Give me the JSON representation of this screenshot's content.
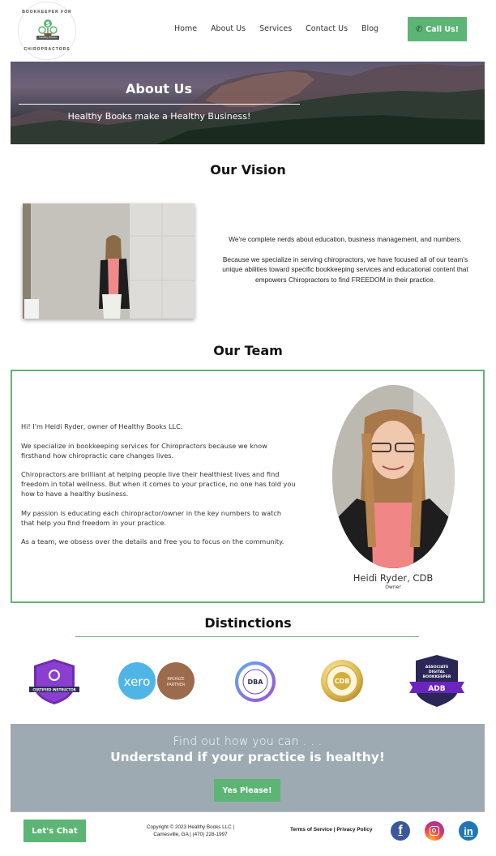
{
  "header": {
    "logo": {
      "ring_top": "BOOKKEEPER FOR",
      "ring_bottom": "CHIROPRACTORS",
      "label": "Healthy Books"
    },
    "nav": [
      {
        "label": "Home"
      },
      {
        "label": "About Us"
      },
      {
        "label": "Services"
      },
      {
        "label": "Contact Us"
      },
      {
        "label": "Blog"
      }
    ],
    "call_button": {
      "icon": "phone-icon",
      "label": "Call Us!"
    }
  },
  "hero": {
    "title": "About Us",
    "subtitle": "Healthy Books make a Healthy Business!"
  },
  "vision": {
    "title": "Our Vision",
    "paragraphs": [
      "We're complete nerds about education, business management, and numbers.",
      "Because we specialize in serving chiropractors, we have focused all of our team's unique abilities toward specific bookkeeping services and educational content that empowers Chiropractors to find FREEDOM in their practice."
    ]
  },
  "team": {
    "title": "Our Team",
    "paragraphs": [
      "Hi! I'm Heidi Ryder, owner of Healthy Books LLC.",
      "We specialize in bookkeeping services for Chiropractors because we know firsthand how chiropractic care changes lives.",
      "Chiropractors are brilliant at helping people live their healthiest lives and find freedom in total wellness. But when it comes to your practice, no one has told you how to have a healthy business.",
      "My passion is educating each chiropractor/owner in the key numbers to watch that help you find freedom in your practice.",
      "As a team, we obsess over the details and free you to focus on the community."
    ],
    "member_name": "Heidi Ryder, CDB",
    "member_role": "Owner"
  },
  "distinctions": {
    "title": "Distinctions",
    "badges": [
      {
        "name": "bookkeepers-certified-instructor",
        "text": "CERTIFIED INSTRUCTOR"
      },
      {
        "name": "xero-bronze-partner",
        "text": "xero",
        "text2": "BRONZE PARTNER"
      },
      {
        "name": "dba-chapter-member",
        "text": "DBA"
      },
      {
        "name": "cdb-certification",
        "text": "CDB"
      },
      {
        "name": "associate-digital-bookkeeper",
        "text": "ASSOCIATE DIGITAL BOOKKEEPER",
        "text2": "ADB"
      }
    ]
  },
  "cta": {
    "subtitle": "Find out how you can . . .",
    "title": "Understand if your practice is healthy!",
    "button": "Yes Please!"
  },
  "footer": {
    "chat_button": "Let's Chat",
    "copyright_line1": "Copyright © 2023 Healthy Books LLC |",
    "copyright_line2": "Camesville, GA | (470) 228-1997",
    "terms": "Terms of Service",
    "separator": " | ",
    "privacy": "Privacy Policy",
    "social": [
      {
        "name": "facebook",
        "glyph": "f"
      },
      {
        "name": "instagram"
      },
      {
        "name": "linkedin",
        "glyph": "in"
      }
    ]
  },
  "colors": {
    "accent_green": "#5cb574",
    "border_green": "#66b07a",
    "cta_background": "#9daab2"
  }
}
